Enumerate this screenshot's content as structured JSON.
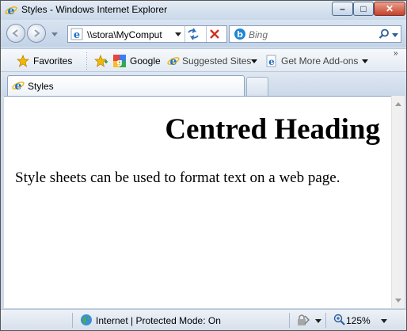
{
  "window": {
    "title": "Styles - Windows Internet Explorer",
    "minimize_glyph": "–",
    "maximize_glyph": "□",
    "close_glyph": "✕"
  },
  "navigation": {
    "address": "\\\\stora\\MyComput",
    "search_placeholder": "Bing"
  },
  "favorites_bar": {
    "favorites_label": "Favorites",
    "items": [
      {
        "label": "Google",
        "icon": "google-icon"
      },
      {
        "label": "Suggested Sites",
        "icon": "ie-icon",
        "has_dropdown": true
      },
      {
        "label": "Get More Add-ons",
        "icon": "ie-page-icon",
        "has_dropdown": true
      }
    ],
    "overflow_glyph": "»"
  },
  "tabs": [
    {
      "label": "Styles",
      "active": true
    }
  ],
  "page": {
    "heading": "Centred Heading",
    "paragraph": "Style sheets can be used to format text on a web page."
  },
  "status_bar": {
    "zone_text": "Internet | Protected Mode: On",
    "zoom": "125%"
  },
  "colors": {
    "chrome_blue": "#cfdbe8",
    "close_red": "#c4412b",
    "ie_blue": "#1e6fc8",
    "favorites_star": "#f5b800"
  }
}
